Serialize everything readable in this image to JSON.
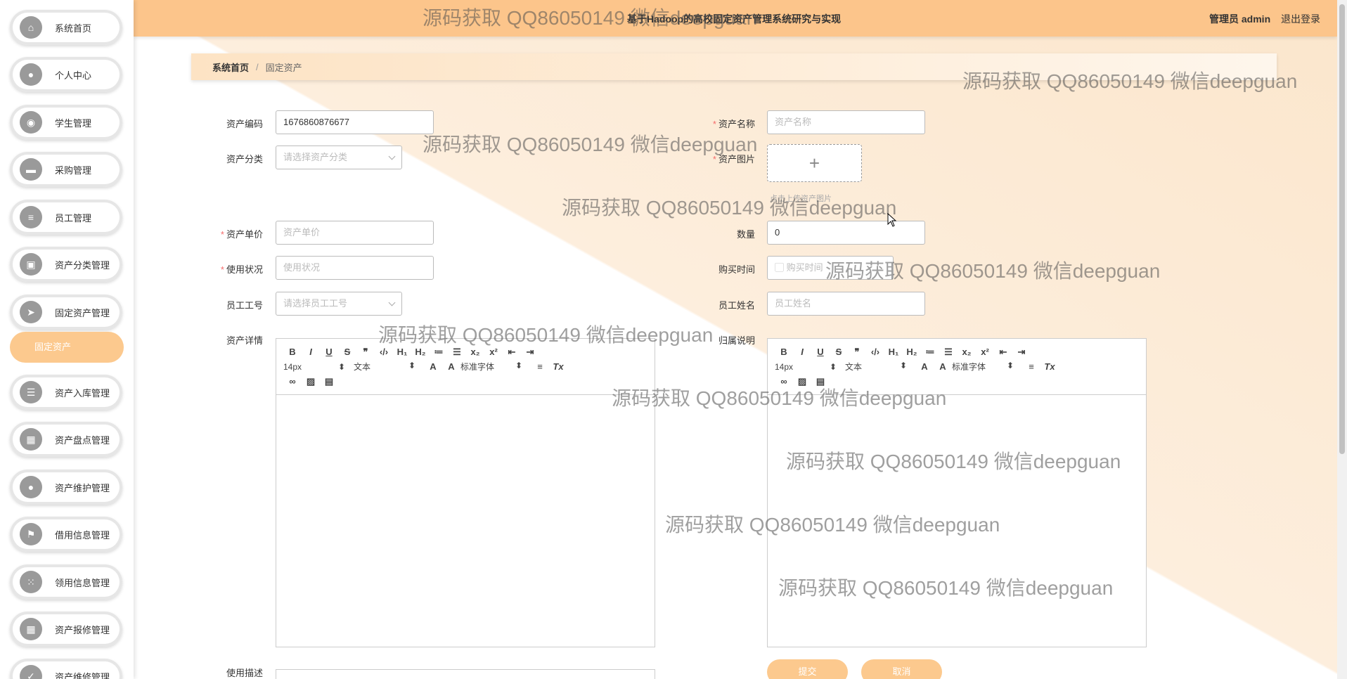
{
  "app": {
    "title": "基于Hadoop的高校固定资产管理系统研究与实现",
    "user": "管理员 admin",
    "logout": "退出登录"
  },
  "sidebar": {
    "items": [
      {
        "label": "系统首页",
        "icon": "home-icon"
      },
      {
        "label": "个人中心",
        "icon": "user-icon"
      },
      {
        "label": "学生管理",
        "icon": "bulb-icon"
      },
      {
        "label": "采购管理",
        "icon": "briefcase-icon"
      },
      {
        "label": "员工管理",
        "icon": "list-icon"
      },
      {
        "label": "资产分类管理",
        "icon": "printer-icon"
      },
      {
        "label": "固定资产管理",
        "icon": "send-icon"
      },
      {
        "label": "资产入库管理",
        "icon": "sliders-icon"
      },
      {
        "label": "资产盘点管理",
        "icon": "grid-icon"
      },
      {
        "label": "资产维护管理",
        "icon": "person-icon"
      },
      {
        "label": "借用信息管理",
        "icon": "flag-icon"
      },
      {
        "label": "领用信息管理",
        "icon": "apps-icon"
      },
      {
        "label": "资产报修管理",
        "icon": "grid-icon"
      },
      {
        "label": "资产维修管理",
        "icon": "check-icon"
      }
    ],
    "active_sub": "固定资产"
  },
  "breadcrumb": {
    "home": "系统首页",
    "sep": "/",
    "current": "固定资产"
  },
  "form": {
    "asset_code": {
      "label": "资产编码",
      "value": "1676860876677"
    },
    "asset_name": {
      "label": "资产名称",
      "placeholder": "资产名称"
    },
    "asset_category": {
      "label": "资产分类",
      "placeholder": "请选择资产分类"
    },
    "asset_image": {
      "label": "资产图片",
      "plus": "+",
      "tip": "点击上传资产图片"
    },
    "unit_price": {
      "label": "资产单价",
      "placeholder": "资产单价"
    },
    "quantity": {
      "label": "数量",
      "value": "0"
    },
    "usage_status": {
      "label": "使用状况",
      "placeholder": "使用状况"
    },
    "purchase_time": {
      "label": "购买时间",
      "placeholder": "购买时间"
    },
    "employee_no": {
      "label": "员工工号",
      "placeholder": "请选择员工工号"
    },
    "employee_name": {
      "label": "员工姓名",
      "placeholder": "员工姓名"
    },
    "asset_detail": {
      "label": "资产详情"
    },
    "ownership_desc": {
      "label": "归属说明"
    },
    "usage_desc": {
      "label": "使用描述"
    },
    "submit": "提交",
    "cancel": "取消"
  },
  "editor_toolbar": {
    "font_size": "14px",
    "heading": "文本",
    "font_family": "标准字体"
  },
  "watermark": "源码获取 QQ86050149 微信deepguan",
  "colors": {
    "accent": "#fcc58b",
    "button": "#fcc98e"
  }
}
